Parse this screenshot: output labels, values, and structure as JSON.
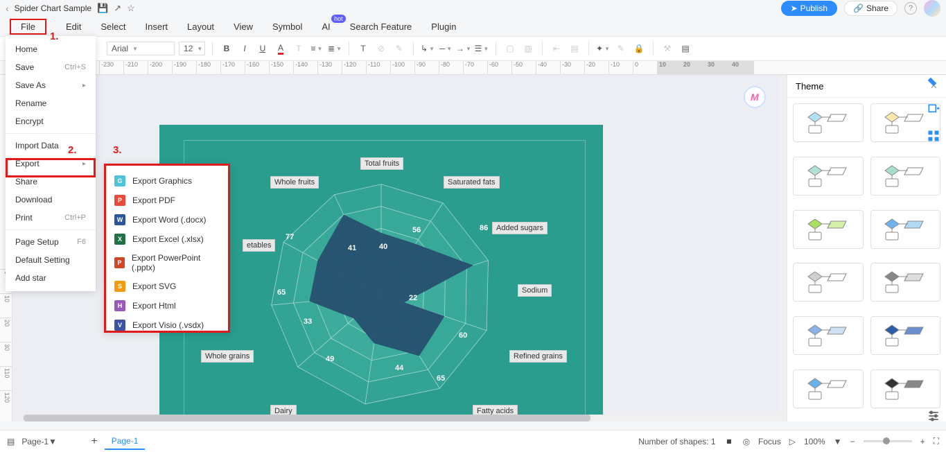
{
  "title": "Spider Chart Sample",
  "topbar": {
    "publish": "Publish",
    "share": "Share"
  },
  "annotations": {
    "one": "1.",
    "two": "2.",
    "three": "3."
  },
  "menu": {
    "file": "File",
    "edit": "Edit",
    "select": "Select",
    "insert": "Insert",
    "layout": "Layout",
    "view": "View",
    "symbol": "Symbol",
    "ai": "AI",
    "ai_badge": "hot",
    "search": "Search Feature",
    "plugin": "Plugin"
  },
  "toolbar": {
    "font": "Arial",
    "size": "12"
  },
  "ruler_h": [
    "-230",
    "-210",
    "-200",
    "-190",
    "-180",
    "-170",
    "-160",
    "-150",
    "-140",
    "-130",
    "-120",
    "-110",
    "-100",
    "-90",
    "-80",
    "-70",
    "-60",
    "-50",
    "-40",
    "-30",
    "-20",
    "-10",
    "0",
    "10",
    "20",
    "30",
    "40"
  ],
  "ruler_h_hl_start": 23,
  "ruler_v": [
    "0",
    "10",
    "20",
    "30",
    "110",
    "120"
  ],
  "file_menu": {
    "home": "Home",
    "save": "Save",
    "save_sc": "Ctrl+S",
    "saveas": "Save As",
    "rename": "Rename",
    "encrypt": "Encrypt",
    "import": "Import Data",
    "export": "Export",
    "share": "Share",
    "download": "Download",
    "print": "Print",
    "print_sc": "Ctrl+P",
    "pagesetup": "Page Setup",
    "pagesetup_sc": "F6",
    "default": "Default Setting",
    "addstar": "Add star"
  },
  "export_menu": {
    "graphics": "Export Graphics",
    "pdf": "Export PDF",
    "word": "Export Word (.docx)",
    "excel": "Export Excel (.xlsx)",
    "ppt": "Export PowerPoint (.pptx)",
    "svg": "Export SVG",
    "html": "Export Html",
    "visio": "Export Visio (.vsdx)"
  },
  "theme": {
    "title": "Theme"
  },
  "chart_data": {
    "type": "radar",
    "categories": [
      "Total fruits",
      "Saturated fats",
      "Added sugars",
      "Sodium",
      "Refined grains",
      "Fatty acids",
      "Dairy",
      "Whole grains",
      "Vegetables",
      "Whole fruits"
    ],
    "partial_categories": [
      "etables"
    ],
    "values": [
      56,
      null,
      86,
      22,
      60,
      65,
      44,
      49,
      33,
      65,
      77,
      41,
      40
    ],
    "value_labels": [
      "56",
      "86",
      "22",
      "60",
      "65",
      "44",
      "49",
      "33",
      "65",
      "77",
      "41",
      "40"
    ],
    "rings": 5
  },
  "status": {
    "page_sel": "Page-1",
    "page_tab": "Page-1",
    "shapes": "Number of shapes: 1",
    "focus": "Focus",
    "zoom": "100%"
  },
  "m_badge": "M"
}
